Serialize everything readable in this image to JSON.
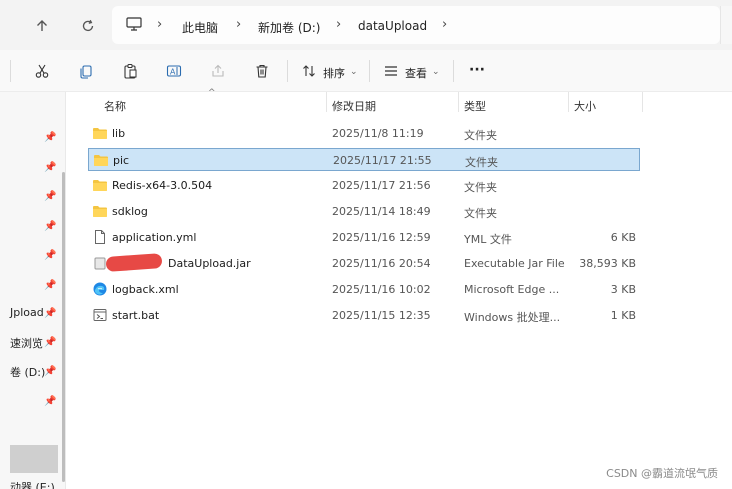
{
  "address_bar": {
    "crumbs": [
      "此电脑",
      "新加卷 (D:)",
      "dataUpload"
    ]
  },
  "toolbar": {
    "sort_label": "排序",
    "view_label": "查看",
    "more_label": "···"
  },
  "nav_pane": {
    "labels": [
      "Jpload",
      "速浏览",
      "卷 (D:)",
      "动器 (E:)"
    ]
  },
  "columns": {
    "name": "名称",
    "date": "修改日期",
    "type": "类型",
    "size": "大小"
  },
  "files": [
    {
      "name": "lib",
      "date": "2025/11/8 11:19",
      "type": "文件夹",
      "size": "",
      "icon": "folder-icon"
    },
    {
      "name": "pic",
      "date": "2025/11/17 21:55",
      "type": "文件夹",
      "size": "",
      "icon": "folder-icon"
    },
    {
      "name": "Redis-x64-3.0.504",
      "date": "2025/11/17 21:56",
      "type": "文件夹",
      "size": "",
      "icon": "folder-icon"
    },
    {
      "name": "sdklog",
      "date": "2025/11/14 18:49",
      "type": "文件夹",
      "size": "",
      "icon": "folder-icon"
    },
    {
      "name": "application.yml",
      "date": "2025/11/16 12:59",
      "type": "YML 文件",
      "size": "6 KB",
      "icon": "document-icon"
    },
    {
      "name": "DataUpload.jar",
      "date": "2025/11/16 20:54",
      "type": "Executable Jar File",
      "size": "38,593 KB",
      "icon": "jar-icon"
    },
    {
      "name": "logback.xml",
      "date": "2025/11/16 10:02",
      "type": "Microsoft Edge ...",
      "size": "3 KB",
      "icon": "edge-icon"
    },
    {
      "name": "start.bat",
      "date": "2025/11/15 12:35",
      "type": "Windows 批处理...",
      "size": "1 KB",
      "icon": "batch-icon"
    }
  ],
  "selected_index": 1,
  "watermark": "CSDN @霸道流氓气质"
}
